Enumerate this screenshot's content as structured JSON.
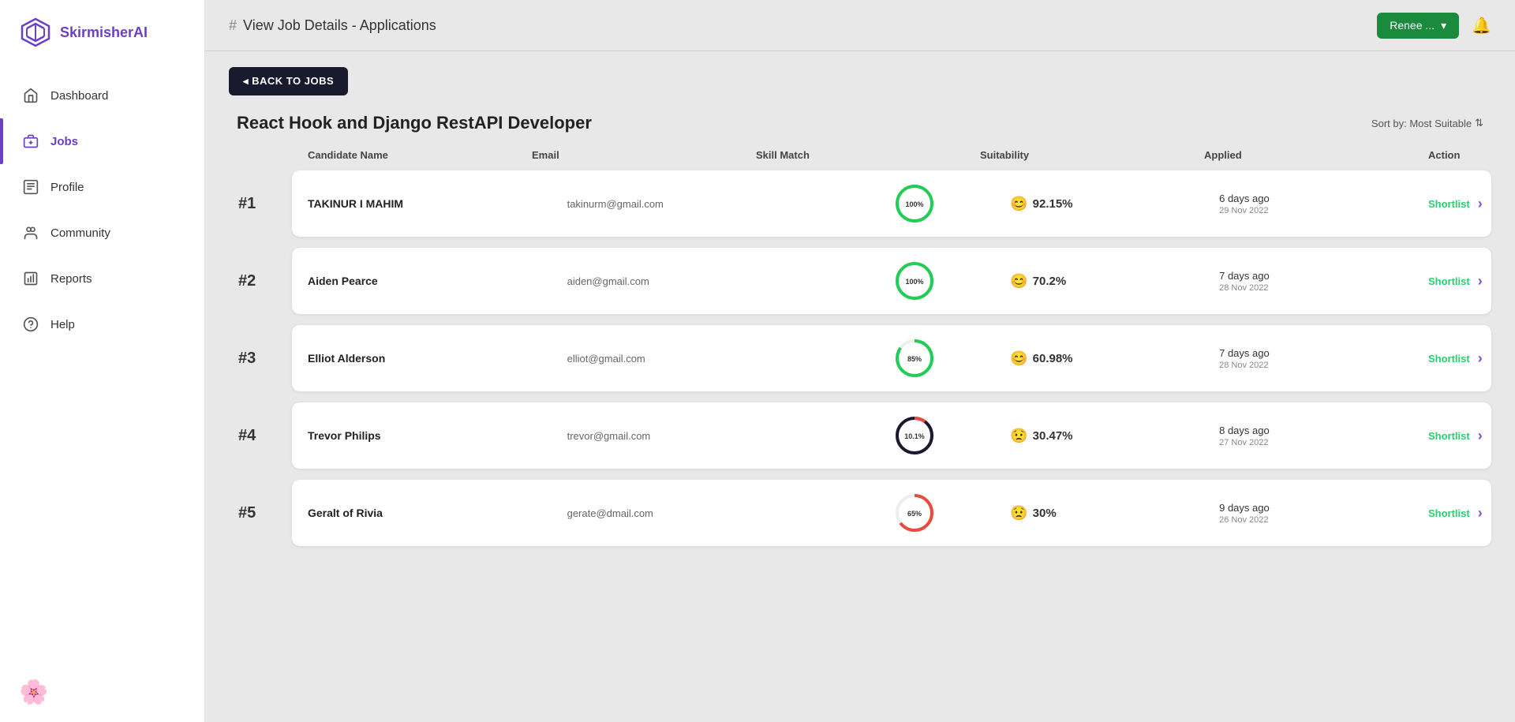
{
  "sidebar": {
    "logo_text": "SkirmisherAI",
    "nav_items": [
      {
        "id": "dashboard",
        "label": "Dashboard",
        "active": false
      },
      {
        "id": "jobs",
        "label": "Jobs",
        "active": true
      },
      {
        "id": "profile",
        "label": "Profile",
        "active": false
      },
      {
        "id": "community",
        "label": "Community",
        "active": false
      },
      {
        "id": "reports",
        "label": "Reports",
        "active": false
      },
      {
        "id": "help",
        "label": "Help",
        "active": false
      }
    ]
  },
  "header": {
    "hash": "#",
    "title": "View Job Details - Applications",
    "user_label": "Renee ...",
    "chevron": "▾"
  },
  "back_button": "◂ BACK TO JOBS",
  "page": {
    "title": "React Hook and Django RestAPI Developer",
    "sort_label": "Sort by: Most Suitable",
    "columns": {
      "candidate_name": "Candidate Name",
      "email": "Email",
      "skill_match": "Skill Match",
      "suitability": "Suitability",
      "applied": "Applied",
      "action": "Action"
    }
  },
  "candidates": [
    {
      "rank": "#1",
      "name": "TAKINUR I MAHIM",
      "email": "takinurm@gmail.com",
      "skill_pct": 100,
      "skill_label": "100%",
      "skill_color": "#22cc55",
      "suitability_pct": "92.15%",
      "suitability_icon": "happy",
      "applied_ago": "6 days ago",
      "applied_date": "29 Nov 2022",
      "action": "Shortlist"
    },
    {
      "rank": "#2",
      "name": "Aiden Pearce",
      "email": "aiden@gmail.com",
      "skill_pct": 100,
      "skill_label": "100%",
      "skill_color": "#22cc55",
      "suitability_pct": "70.2%",
      "suitability_icon": "happy",
      "applied_ago": "7 days ago",
      "applied_date": "28 Nov 2022",
      "action": "Shortlist"
    },
    {
      "rank": "#3",
      "name": "Elliot Alderson",
      "email": "elliot@gmail.com",
      "skill_pct": 85,
      "skill_label": "85%",
      "skill_color": "#22cc55",
      "suitability_pct": "60.98%",
      "suitability_icon": "happy",
      "applied_ago": "7 days ago",
      "applied_date": "28 Nov 2022",
      "action": "Shortlist"
    },
    {
      "rank": "#4",
      "name": "Trevor Philips",
      "email": "trevor@gmail.com",
      "skill_pct": 10.1,
      "skill_label": "10.1%",
      "skill_color": "#e74c3c",
      "suitability_pct": "30.47%",
      "suitability_icon": "sad",
      "applied_ago": "8 days ago",
      "applied_date": "27 Nov 2022",
      "action": "Shortlist"
    },
    {
      "rank": "#5",
      "name": "Geralt of Rivia",
      "email": "gerate@dmail.com",
      "skill_pct": 65,
      "skill_label": "65%",
      "skill_color": "#e74c3c",
      "suitability_pct": "30%",
      "suitability_icon": "sad",
      "applied_ago": "9 days ago",
      "applied_date": "26 Nov 2022",
      "action": "Shortlist"
    }
  ]
}
